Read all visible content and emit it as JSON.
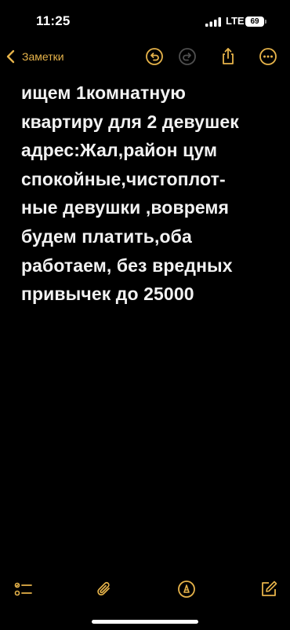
{
  "status_bar": {
    "time": "11:25",
    "network": "LTE",
    "battery": "69"
  },
  "nav": {
    "back_label": "Заметки",
    "accent_color": "#e6b34a"
  },
  "note": {
    "text": "ищем 1комнатную\nквартиру для 2 девушек\nадрес:Жал,район цум\nспокойные,чистоплот-\nные девушки ,вовремя\nбудем платить,оба\nработаем, без вредных\nпривычек до 25000"
  },
  "toolbar": {
    "icons": [
      "checklist-icon",
      "paperclip-icon",
      "markup-pen-icon",
      "compose-icon"
    ]
  }
}
